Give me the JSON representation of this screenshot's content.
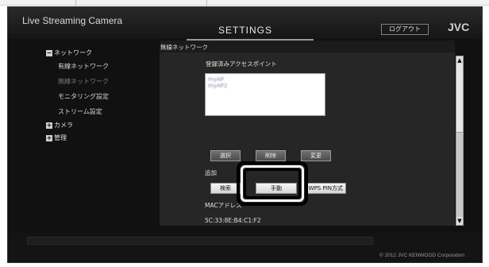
{
  "header": {
    "app_title": "Live Streaming Camera",
    "page_title": "SETTINGS",
    "logout_label": "ログアウト",
    "brand": "JVC"
  },
  "sidebar": {
    "groups": [
      {
        "label": "ネットワーク",
        "expanded": true,
        "toggle": "−"
      },
      {
        "label": "カメラ",
        "expanded": false,
        "toggle": "+"
      },
      {
        "label": "管理",
        "expanded": false,
        "toggle": "+"
      }
    ],
    "network_items": [
      {
        "label": "有線ネットワーク",
        "active": false
      },
      {
        "label": "無線ネットワーク",
        "active": true
      },
      {
        "label": "モニタリング設定",
        "active": false
      },
      {
        "label": "ストリーム設定",
        "active": false
      }
    ]
  },
  "main": {
    "section_title": "無線ネットワーク",
    "registered_ap_label": "登録済みアクセスポイント",
    "access_points": [
      "myAP",
      "myAP2"
    ],
    "action_buttons": {
      "select": "選択",
      "delete": "削除",
      "change": "変更"
    },
    "add_label": "追加",
    "add_buttons": {
      "search": "検索",
      "manual": "手動",
      "wps_pin": "WPS PIN方式"
    },
    "mac_label": "MACアドレス",
    "mac_value": "5C:33:8E:B4:C1:F2"
  },
  "footer": {
    "copyright": "© 2012 JVC KENWOOD Corporation"
  },
  "colors": {
    "app_background": "#111111",
    "panel": "#262626",
    "highlight": "#000000"
  }
}
